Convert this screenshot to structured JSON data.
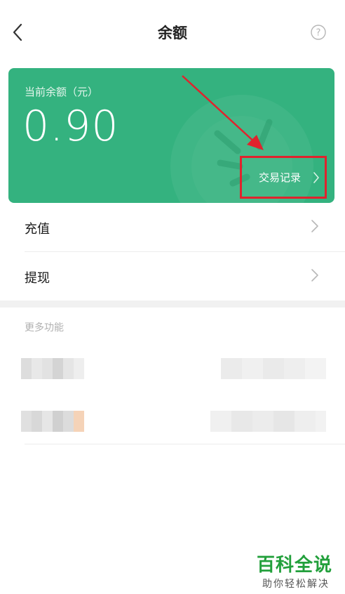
{
  "header": {
    "title": "余额",
    "back_icon": "chevron-left-icon",
    "help_icon": "question-circle-icon"
  },
  "balance_card": {
    "label": "当前余额（元）",
    "amount": "0.90",
    "transaction_link": "交易记录",
    "background_color": "#34b27f",
    "highlight_color": "#e0232d"
  },
  "menu": {
    "items": [
      {
        "label": "充值"
      },
      {
        "label": "提现"
      }
    ]
  },
  "more_section": {
    "title": "更多功能"
  },
  "watermark": {
    "main": "百科全说",
    "sub": "助你轻松解决"
  }
}
